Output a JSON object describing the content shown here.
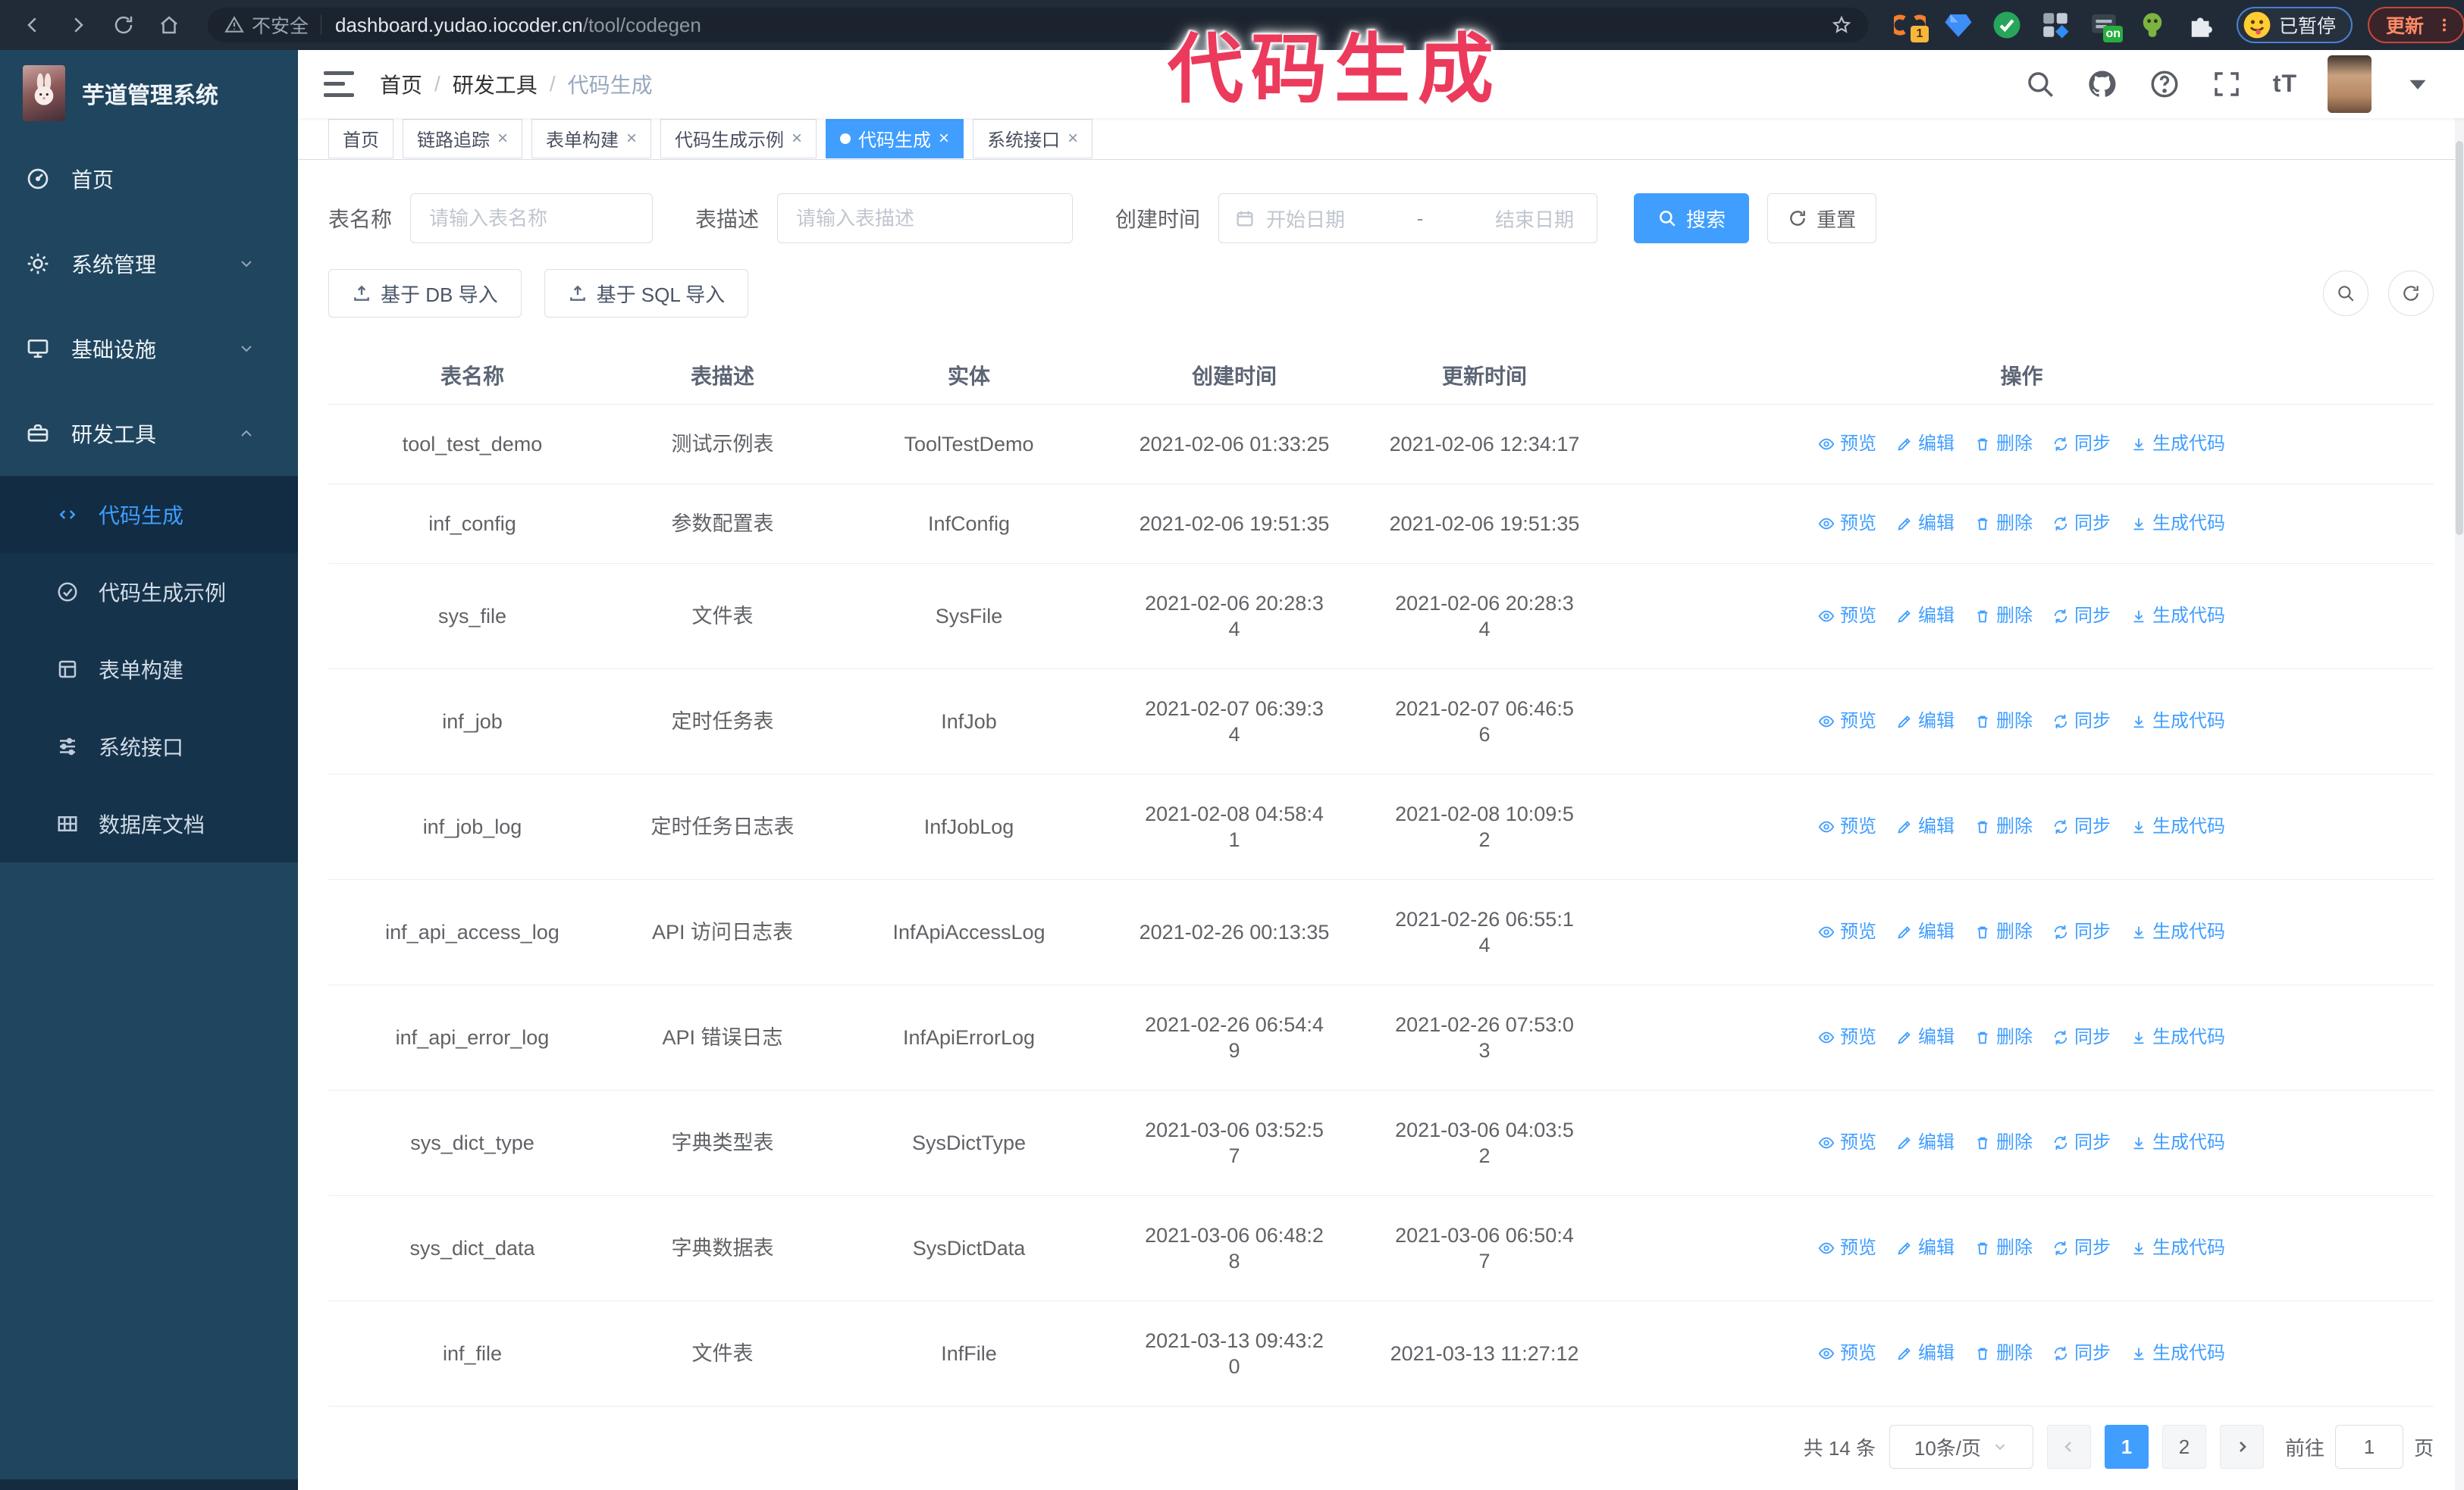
{
  "browser": {
    "security_warning": "不安全",
    "url_domain": "dashboard.yudao.iocoder.cn",
    "url_path": "/tool/codegen",
    "paused_badge": "已暂停",
    "update_button": "更新",
    "extension_badge_count": "1",
    "extension_badge_on": "on"
  },
  "overlay": {
    "title": "代码生成"
  },
  "sidebar": {
    "app_title": "芋道管理系统",
    "items": [
      {
        "label": "首页",
        "icon": "home-menu",
        "expandable": false
      },
      {
        "label": "系统管理",
        "icon": "gear",
        "expandable": true,
        "state": "collapsed"
      },
      {
        "label": "基础设施",
        "icon": "infra",
        "expandable": true,
        "state": "collapsed"
      },
      {
        "label": "研发工具",
        "icon": "tools",
        "expandable": true,
        "state": "expanded"
      }
    ],
    "submenu": [
      {
        "label": "代码生成",
        "icon": "code",
        "active": true
      },
      {
        "label": "代码生成示例",
        "icon": "example",
        "active": false
      },
      {
        "label": "表单构建",
        "icon": "form",
        "active": false
      },
      {
        "label": "系统接口",
        "icon": "api",
        "active": false
      },
      {
        "label": "数据库文档",
        "icon": "dbdoc",
        "active": false
      }
    ]
  },
  "navbar": {
    "breadcrumb": [
      "首页",
      "研发工具",
      "代码生成"
    ]
  },
  "tabs": [
    {
      "label": "首页",
      "closable": false,
      "active": false
    },
    {
      "label": "链路追踪",
      "closable": true,
      "active": false
    },
    {
      "label": "表单构建",
      "closable": true,
      "active": false
    },
    {
      "label": "代码生成示例",
      "closable": true,
      "active": false
    },
    {
      "label": "代码生成",
      "closable": true,
      "active": true
    },
    {
      "label": "系统接口",
      "closable": true,
      "active": false
    }
  ],
  "search_form": {
    "table_name_label": "表名称",
    "table_name_placeholder": "请输入表名称",
    "table_desc_label": "表描述",
    "table_desc_placeholder": "请输入表描述",
    "create_time_label": "创建时间",
    "start_date_placeholder": "开始日期",
    "range_separator": "-",
    "end_date_placeholder": "结束日期",
    "search_button": "搜索",
    "reset_button": "重置"
  },
  "toolbar": {
    "import_db_button": "基于 DB 导入",
    "import_sql_button": "基于 SQL 导入"
  },
  "table": {
    "columns": [
      "表名称",
      "表描述",
      "实体",
      "创建时间",
      "更新时间",
      "操作"
    ],
    "actions": [
      "预览",
      "编辑",
      "删除",
      "同步",
      "生成代码"
    ],
    "rows": [
      {
        "name": "tool_test_demo",
        "desc": "测试示例表",
        "entity": "ToolTestDemo",
        "created": "2021-02-06 01:33:25",
        "updated": "2021-02-06 12:34:17"
      },
      {
        "name": "inf_config",
        "desc": "参数配置表",
        "entity": "InfConfig",
        "created": "2021-02-06 19:51:35",
        "updated": "2021-02-06 19:51:35"
      },
      {
        "name": "sys_file",
        "desc": "文件表",
        "entity": "SysFile",
        "created": "2021-02-06 20:28:3\n4",
        "updated": "2021-02-06 20:28:3\n4"
      },
      {
        "name": "inf_job",
        "desc": "定时任务表",
        "entity": "InfJob",
        "created": "2021-02-07 06:39:3\n4",
        "updated": "2021-02-07 06:46:5\n6"
      },
      {
        "name": "inf_job_log",
        "desc": "定时任务日志表",
        "entity": "InfJobLog",
        "created": "2021-02-08 04:58:4\n1",
        "updated": "2021-02-08 10:09:5\n2"
      },
      {
        "name": "inf_api_access_log",
        "desc": "API 访问日志表",
        "entity": "InfApiAccessLog",
        "created": "2021-02-26 00:13:35",
        "updated": "2021-02-26 06:55:1\n4"
      },
      {
        "name": "inf_api_error_log",
        "desc": "API 错误日志",
        "entity": "InfApiErrorLog",
        "created": "2021-02-26 06:54:4\n9",
        "updated": "2021-02-26 07:53:0\n3"
      },
      {
        "name": "sys_dict_type",
        "desc": "字典类型表",
        "entity": "SysDictType",
        "created": "2021-03-06 03:52:5\n7",
        "updated": "2021-03-06 04:03:5\n2"
      },
      {
        "name": "sys_dict_data",
        "desc": "字典数据表",
        "entity": "SysDictData",
        "created": "2021-03-06 06:48:2\n8",
        "updated": "2021-03-06 06:50:4\n7"
      },
      {
        "name": "inf_file",
        "desc": "文件表",
        "entity": "InfFile",
        "created": "2021-03-13 09:43:2\n0",
        "updated": "2021-03-13 11:27:12"
      }
    ]
  },
  "pagination": {
    "total_text": "共 14 条",
    "page_size": "10条/页",
    "pages": [
      "1",
      "2"
    ],
    "active_page": "1",
    "goto_label": "前往",
    "goto_value": "1",
    "page_suffix": "页"
  },
  "colors": {
    "accent": "#409eff",
    "sidebar_bg": "#20455e",
    "submenu_bg": "#16334c",
    "overlay_pink": "#ec3a5c",
    "active_tab": "#409eff"
  }
}
